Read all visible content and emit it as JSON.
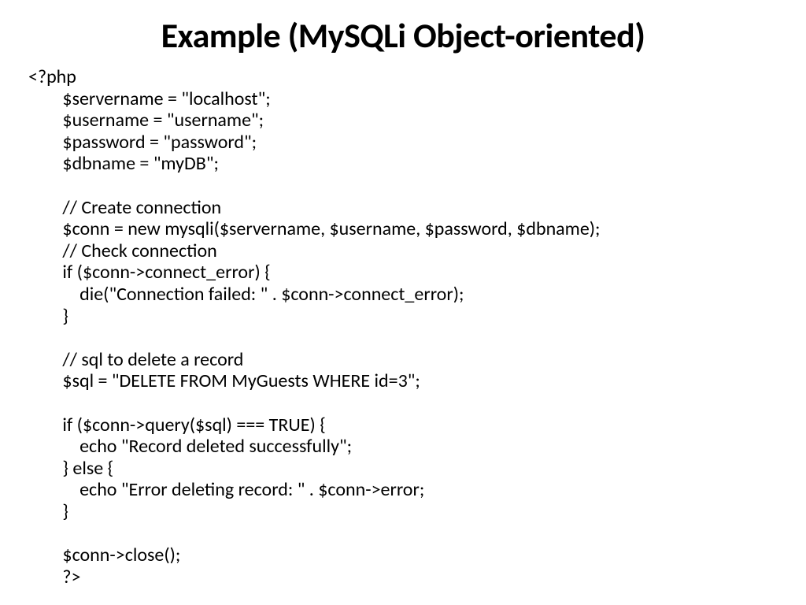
{
  "slide": {
    "title": "Example (MySQLi Object-oriented)",
    "code": "<?php\n\t$servername = \"localhost\";\n\t$username = \"username\";\n\t$password = \"password\";\n\t$dbname = \"myDB\";\n\n\t// Create connection\n\t$conn = new mysqli($servername, $username, $password, $dbname);\n\t// Check connection\n\tif ($conn->connect_error) {\n\t    die(\"Connection failed: \" . $conn->connect_error);\n\t} \n\n\t// sql to delete a record\n\t$sql = \"DELETE FROM MyGuests WHERE id=3\";\n\n\tif ($conn->query($sql) === TRUE) {\n\t    echo \"Record deleted successfully\";\n\t} else {\n\t    echo \"Error deleting record: \" . $conn->error;\n\t}\n\n\t$conn->close();\n\t?>"
  }
}
